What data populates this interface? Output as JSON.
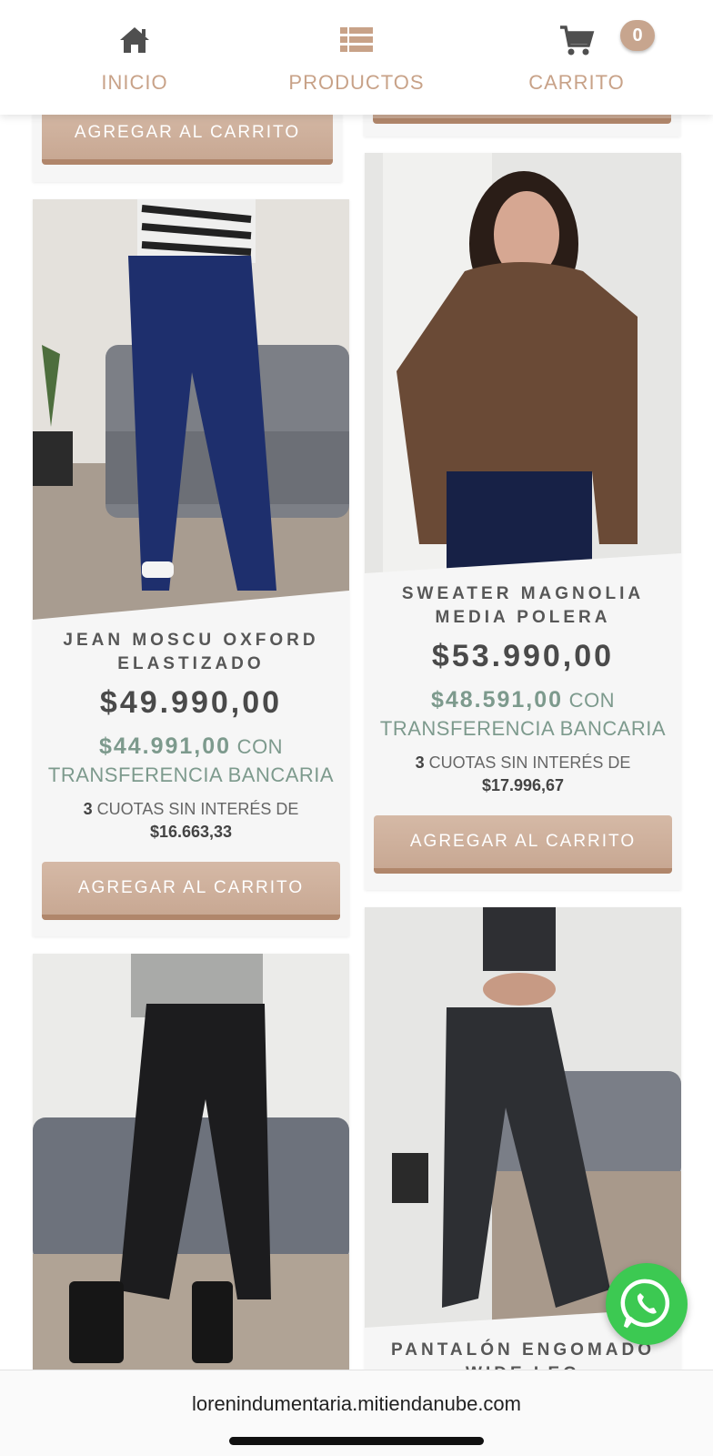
{
  "nav": {
    "items": [
      {
        "label": "INICIO",
        "icon": "home-icon"
      },
      {
        "label": "PRODUCTOS",
        "icon": "list-icon"
      },
      {
        "label": "CARRITO",
        "icon": "cart-icon"
      }
    ],
    "cart_count": "0"
  },
  "colors": {
    "accent": "#c8a288",
    "button": "#d0b19c",
    "transfer_price": "#7d9a8d",
    "whatsapp": "#3cc952"
  },
  "products": [
    {
      "name": "",
      "button": "AGREGAR AL CARRITO"
    },
    {
      "name": "",
      "button": ""
    },
    {
      "name": "JEAN MOSCU OXFORD ELASTIZADO",
      "price": "$49.990,00",
      "transfer_price": "$44.991,00",
      "transfer_text": " CON TRANSFERENCIA BANCARIA",
      "installments_count": "3",
      "installments_text": " CUOTAS SIN INTERÉS DE",
      "installment_amount": "$16.663,33",
      "button": "AGREGAR AL CARRITO",
      "image": "model in navy flared jeans and striped sweater"
    },
    {
      "name": "SWEATER MAGNOLIA MEDIA POLERA",
      "price": "$53.990,00",
      "transfer_price": "$48.591,00",
      "transfer_text": " CON TRANSFERENCIA BANCARIA",
      "installments_count": "3",
      "installments_text": " CUOTAS SIN INTERÉS DE",
      "installment_amount": "$17.996,67",
      "button": "AGREGAR AL CARRITO",
      "image": "model in brown knit sweater"
    },
    {
      "name": "",
      "image": "model in black trousers and gray top"
    },
    {
      "name": "PANTALÓN ENGOMADO WIDE LEG",
      "image": "model in black faux leather wide leg pants"
    }
  ],
  "browser": {
    "url": "lorenindumentaria.mitiendanube.com"
  }
}
